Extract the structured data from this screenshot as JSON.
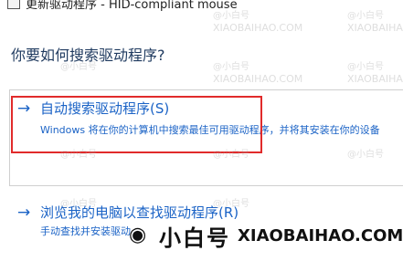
{
  "window": {
    "title": "更新驱动程序 - HID-compliant mouse",
    "icon": "device-icon"
  },
  "main": {
    "heading": "你要如何搜索驱动程序?",
    "options": [
      {
        "title": "自动搜索驱动程序(S)",
        "description": "Windows 将在你的计算机中搜索最佳可用驱动程序，并将其安装在你的设备",
        "icon": "arrow-right-icon",
        "highlighted": true,
        "highlight_color": "#e12b2b"
      },
      {
        "title": "浏览我的电脑以查找驱动程序(R)",
        "description": "手动查找并安装驱动",
        "icon": "arrow-right-icon"
      }
    ]
  },
  "watermark": {
    "mark": "@小白号",
    "domain": "XIAOBAIHAO.COM"
  },
  "brand": {
    "name": "小白号",
    "domain": "XIAOBAIHAO.COM",
    "icon": "wifi-circle-icon"
  },
  "colors": {
    "link": "#1b63c6",
    "highlight": "#e12b2b",
    "heading": "#1f3a5f"
  }
}
